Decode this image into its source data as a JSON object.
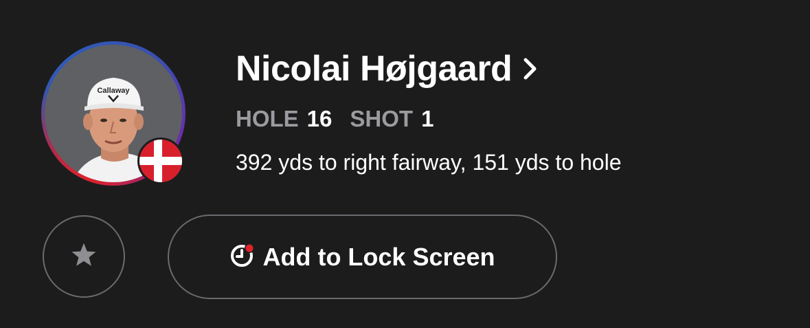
{
  "player": {
    "name": "Nicolai Højgaard",
    "avatar_icon": "player-photo",
    "flag_icon": "denmark-flag-icon",
    "ring_colors": [
      "#2f5bb8",
      "#6a2fa8",
      "#e0222a"
    ]
  },
  "status": {
    "hole_label": "HOLE",
    "hole_value": "16",
    "shot_label": "SHOT",
    "shot_value": "1"
  },
  "distance_text": "392 yds to right fairway, 151 yds to hole",
  "actions": {
    "favorite_icon": "star-icon",
    "lock_screen_label": "Add to Lock Screen",
    "lock_screen_icon": "live-activity-icon",
    "accent_color": "#e0222a"
  }
}
